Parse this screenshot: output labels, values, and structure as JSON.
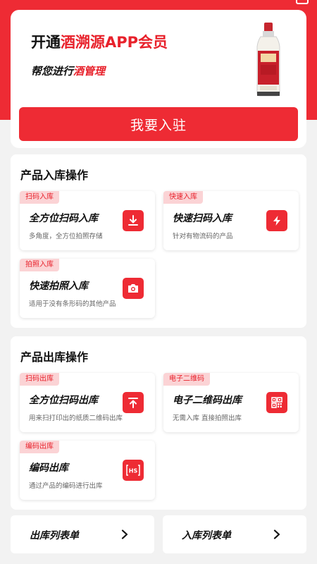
{
  "hero": {
    "title_prefix": "开通",
    "title_highlight": "酒溯源APP会员",
    "subtitle_prefix": "帮您进行",
    "subtitle_highlight": "酒管理",
    "join_button": "我要入驻"
  },
  "inbound": {
    "title": "产品入库操作",
    "cards": [
      {
        "tag": "扫码入库",
        "title": "全方位扫码入库",
        "desc": "多角度，全方位拍照存储",
        "icon": "download-icon"
      },
      {
        "tag": "快速入库",
        "title": "快速扫码入库",
        "desc": "针对有物流码的产品",
        "icon": "lightning-icon"
      },
      {
        "tag": "拍照入库",
        "title": "快速拍照入库",
        "desc": "适用于没有条形码的其他产品",
        "icon": "camera-icon"
      }
    ]
  },
  "outbound": {
    "title": "产品出库操作",
    "cards": [
      {
        "tag": "扫码出库",
        "title": "全方位扫码出库",
        "desc": "用来扫打印出的纸质二维码出库",
        "icon": "upload-icon"
      },
      {
        "tag": "电子二维码",
        "title": "电子二维码出库",
        "desc": "无需入库  直接拍照出库",
        "icon": "qr-code-icon"
      },
      {
        "tag": "编码出库",
        "title": "编码出库",
        "desc": "通过产品的编码进行出库",
        "icon": "hs-code-icon",
        "icon_text": "HS"
      }
    ]
  },
  "lists": {
    "outbound_list": "出库列表单",
    "inbound_list": "入库列表单"
  },
  "colors": {
    "brand_red": "#ee2b34",
    "tag_bg": "#fbd3d5",
    "page_bg": "#f2f2f2"
  }
}
